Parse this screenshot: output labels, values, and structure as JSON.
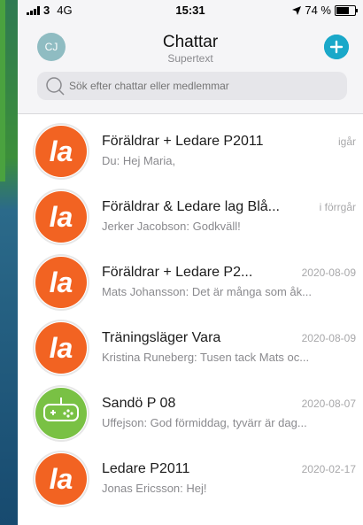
{
  "status": {
    "signal": "3",
    "network": "4G",
    "time": "15:31",
    "battery": "74 %",
    "battery_level": 0.74
  },
  "header": {
    "avatar_initials": "CJ",
    "title": "Chattar",
    "subtitle": "Supertext"
  },
  "search": {
    "placeholder": "Sök efter chattar eller medlemmar"
  },
  "colors": {
    "accent": "#1aa8c9",
    "brand_orange": "#f26322",
    "gamepad_green": "#79c144"
  },
  "chats": [
    {
      "name": "Föräldrar + Ledare P2011",
      "date": "igår",
      "preview": "Du: Hej Maria,",
      "icon": "la-logo"
    },
    {
      "name": "Föräldrar & Ledare lag Blå...",
      "date": "i förrgår",
      "preview": "Jerker Jacobson: Godkväll!",
      "icon": "la-logo"
    },
    {
      "name": "Föräldrar + Ledare P2...",
      "date": "2020-08-09",
      "preview": "Mats Johansson: Det är många som åk...",
      "icon": "la-logo"
    },
    {
      "name": "Träningsläger Vara",
      "date": "2020-08-09",
      "preview": "Kristina Runeberg: Tusen tack Mats oc...",
      "icon": "la-logo"
    },
    {
      "name": "Sandö P 08",
      "date": "2020-08-07",
      "preview": "Uffejson: God förmiddag, tyvärr är dag...",
      "icon": "gamepad-icon"
    },
    {
      "name": "Ledare P2011",
      "date": "2020-02-17",
      "preview": "Jonas Ericsson: Hej!",
      "icon": "la-logo"
    }
  ]
}
